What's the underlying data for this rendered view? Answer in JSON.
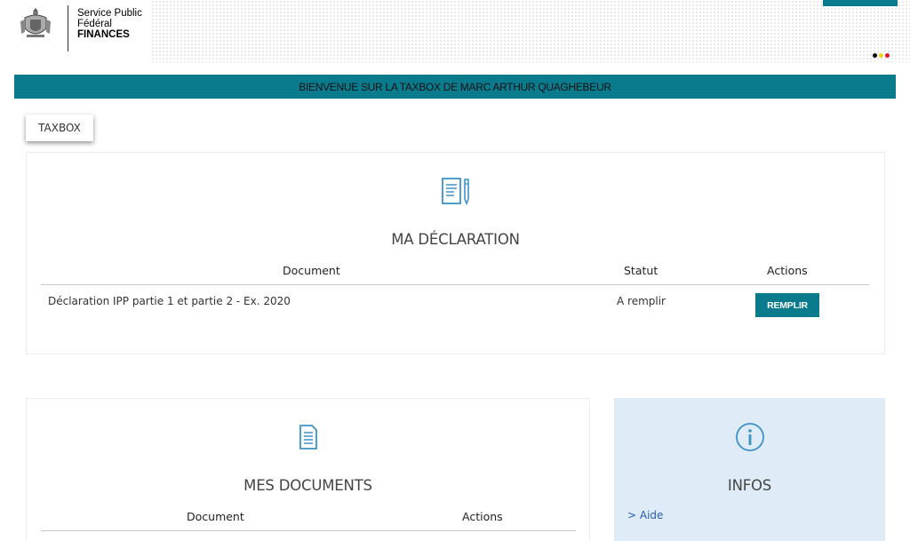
{
  "header": {
    "logo_line1": "Service Public",
    "logo_line2": "Fédéral",
    "logo_line3": "FINANCES",
    "flag_colors": [
      "#000000",
      "#f6d116",
      "#e8112d"
    ],
    "accent_color": "#0a7b8d"
  },
  "banner": {
    "text": "BIENVENUE SUR LA TAXBOX DE MARC ARTHUR QUAGHEBEUR"
  },
  "tabs": [
    {
      "label": "TAXBOX"
    }
  ],
  "declaration": {
    "icon": "document-pen-icon",
    "title": "MA DÉCLARATION",
    "columns": {
      "document": "Document",
      "status": "Statut",
      "actions": "Actions"
    },
    "rows": [
      {
        "document": "Déclaration IPP partie 1 et partie 2 - Ex. 2020",
        "status": "A remplir",
        "action_label": "REMPLIR"
      }
    ]
  },
  "documents": {
    "icon": "document-list-icon",
    "title": "MES DOCUMENTS",
    "columns": {
      "document": "Document",
      "actions": "Actions"
    }
  },
  "infos": {
    "icon": "info-circle-icon",
    "title": "INFOS",
    "links": [
      {
        "label": "> Aide"
      }
    ],
    "background": "#dfebf7"
  }
}
